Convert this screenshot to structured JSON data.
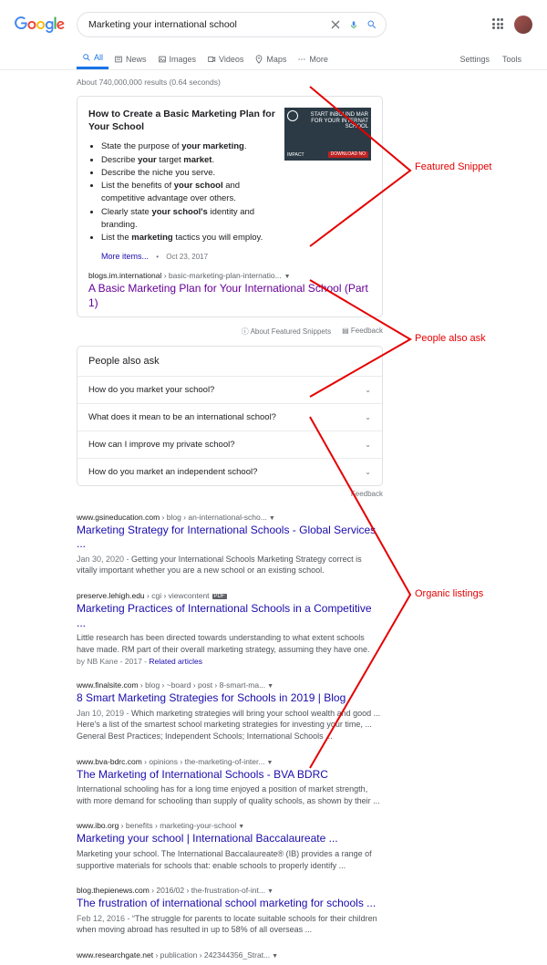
{
  "search": {
    "query": "Marketing your international school",
    "placeholder": ""
  },
  "tabs": {
    "all": "All",
    "news": "News",
    "images": "Images",
    "videos": "Videos",
    "maps": "Maps",
    "more": "More",
    "settings": "Settings",
    "tools": "Tools"
  },
  "stats": "About 740,000,000 results (0.64 seconds)",
  "featured": {
    "title": "How to Create a Basic Marketing Plan for Your School",
    "bullets": {
      "b1a": "State the purpose of ",
      "b1b": "your marketing",
      "b1c": ".",
      "b2a": "Describe ",
      "b2b": "your",
      "b2c": " target ",
      "b2d": "market",
      "b2e": ".",
      "b3": "Describe the niche you serve.",
      "b4a": "List the benefits of ",
      "b4b": "your school",
      "b4c": " and competitive advantage over others.",
      "b5a": "Clearly state ",
      "b5b": "your school's",
      "b5c": " identity and branding.",
      "b6a": "List the ",
      "b6b": "marketing",
      "b6c": " tactics you will employ."
    },
    "img_text": "START INBOUND MAR\nFOR YOUR INTERNAT\nSCHOOL",
    "img_download": "DOWNLOAD NO",
    "img_impact": "IMPACT",
    "more": "More items...",
    "date": "Oct 23, 2017",
    "breadcrumb_domain": "blogs.im.international",
    "breadcrumb_path": " › basic-marketing-plan-internatio...",
    "result_title": "A Basic Marketing Plan for Your International School (Part 1)",
    "about": "About Featured Snippets",
    "feedback": "Feedback"
  },
  "paa": {
    "title": "People also ask",
    "q1": "How do you market your school?",
    "q2": "What does it mean to be an international school?",
    "q3": "How can I improve my private school?",
    "q4": "How do you market an independent school?",
    "feedback": "Feedback"
  },
  "results": {
    "r1": {
      "domain": "www.gsineducation.com",
      "path": " › blog › an-international-scho...",
      "title": "Marketing Strategy for International Schools - Global Services ...",
      "date": "Jan 30, 2020 - ",
      "desc": "Getting your International Schools Marketing Strategy correct is vitally important whether you are a new school or an existing school."
    },
    "r2": {
      "domain": "preserve.lehigh.edu",
      "path": " › cgi › viewcontent",
      "pdf": "PDF",
      "title": "Marketing Practices of International Schools in a Competitive ...",
      "desc": "Little research has been directed towards understanding to what extent schools have made. RM part of their overall marketing strategy, assuming they have one.",
      "by": "by NB Kane - 2017 - ",
      "related": "Related articles"
    },
    "r3": {
      "domain": "www.finalsite.com",
      "path": " › blog › ~board › post › 8-smart-ma...",
      "title": "8 Smart Marketing Strategies for Schools in 2019 | Blog",
      "date": "Jan 10, 2019 - ",
      "desc": "Which marketing strategies will bring your school wealth and good ... Here's a list of the smartest school marketing strategies for investing your time, ... General Best Practices; Independent Schools; International Schools ..."
    },
    "r4": {
      "domain": "www.bva-bdrc.com",
      "path": " › opinions › the-marketing-of-inter...",
      "title": "The Marketing of International Schools - BVA BDRC",
      "desc": "International schooling has for a long time enjoyed a position of market strength, with more demand for schooling than supply of quality schools, as shown by their ..."
    },
    "r5": {
      "domain": "www.ibo.org",
      "path": " › benefits › marketing-your-school",
      "title": "Marketing your school | International Baccalaureate ...",
      "desc": "Marketing your school. The International Baccalaureate® (IB) provides a range of supportive materials for schools that: enable schools to properly identify ..."
    },
    "r6": {
      "domain": "blog.thepienews.com",
      "path": " › 2016/02 › the-frustration-of-int...",
      "title": "The frustration of international school marketing for schools ...",
      "date": "Feb 12, 2016 - ",
      "desc": "“The struggle for parents to locate suitable schools for their children when moving abroad has resulted in up to 58% of all overseas ..."
    },
    "r7": {
      "domain": "www.researchgate.net",
      "path": " › publication › 242344356_Strat..."
    }
  },
  "annotations": {
    "featured": "Featured Snippet",
    "paa": "People also ask",
    "organic": "Organic listings"
  }
}
